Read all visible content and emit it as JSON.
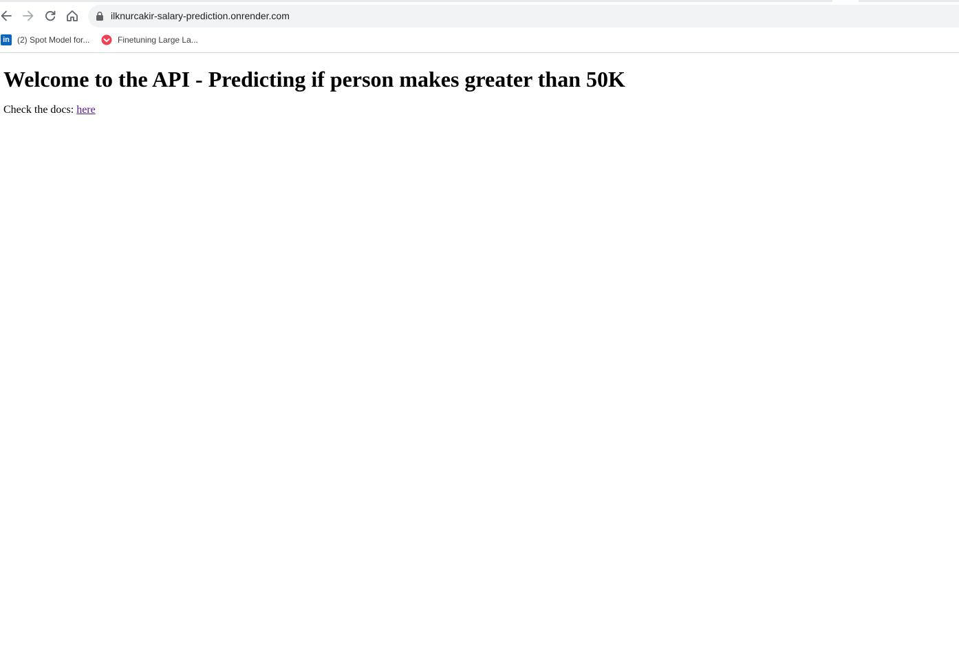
{
  "browser": {
    "address_bar": {
      "url": "ilknurcakir-salary-prediction.onrender.com"
    },
    "bookmarks": [
      {
        "label": "(2) Spot Model for...",
        "icon": "linkedin-icon"
      },
      {
        "label": "Finetuning Large La...",
        "icon": "pocket-icon"
      }
    ],
    "toolbar_icons": [
      "back-arrow-icon",
      "forward-arrow-icon",
      "reload-icon",
      "home-icon",
      "lock-icon"
    ]
  },
  "page": {
    "heading": "Welcome to the API - Predicting if person makes greater than 50K",
    "docs_prefix": "Check the docs: ",
    "docs_link_text": "here",
    "colors": {
      "link_visited": "#551a8b",
      "text": "#000000",
      "background": "#ffffff",
      "omnibox": "#f1f3f4"
    }
  }
}
